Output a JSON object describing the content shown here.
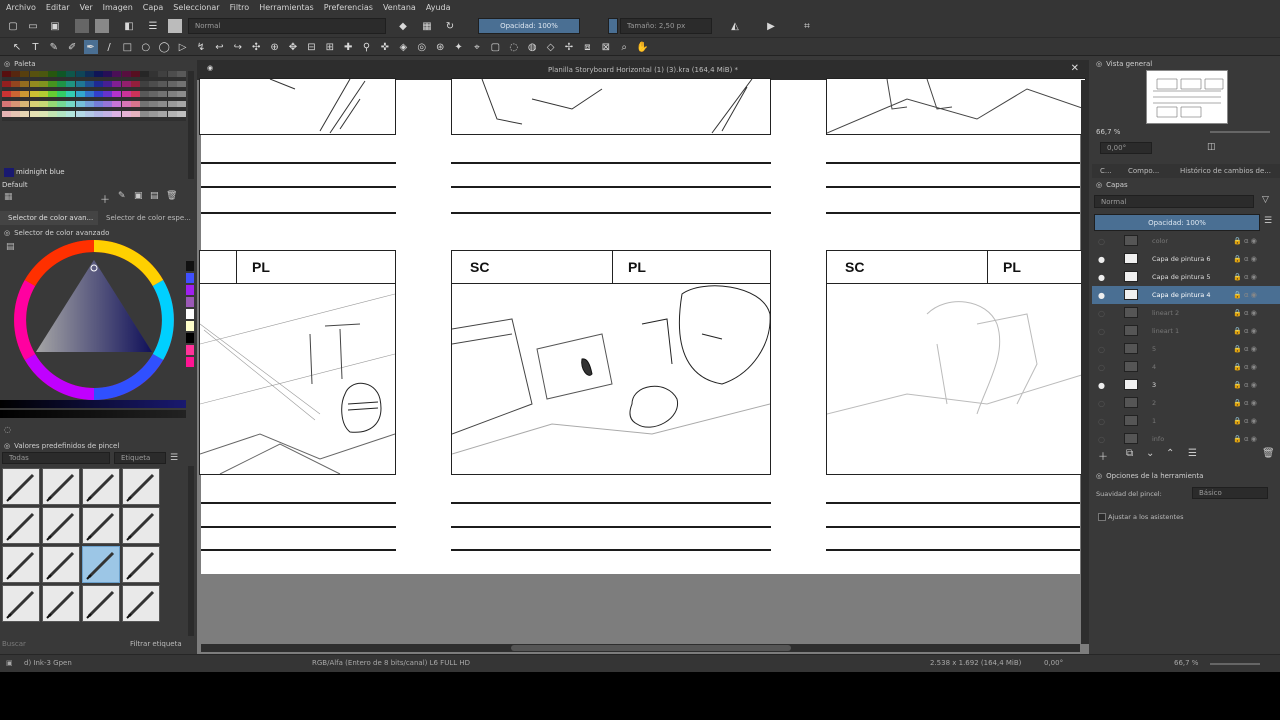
{
  "menu": [
    "Archivo",
    "Editar",
    "Ver",
    "Imagen",
    "Capa",
    "Seleccionar",
    "Filtro",
    "Herramientas",
    "Preferencias",
    "Ventana",
    "Ayuda"
  ],
  "toolbar": {
    "blend_mode": "Normal",
    "opacity": "Opacidad: 100%",
    "size": "Tamaño: 2,50 px"
  },
  "document": {
    "title": "Planilla Storyboard Horizontal (1) (3).kra (164,4 MiB) *",
    "sc_label": "SC",
    "pl_label": "PL"
  },
  "palette": {
    "title": "Paleta",
    "color_name": "midnight blue",
    "set_name": "Default"
  },
  "color_selector": {
    "tabs": [
      "Selector de color avan...",
      "Selector de color espe..."
    ],
    "title": "Selector de color avanzado"
  },
  "brush_presets": {
    "title": "Valores predefinidos de pincel",
    "filter": "Todas",
    "tag_label": "Etiqueta",
    "search_placeholder": "Buscar",
    "filter_tag": "Filtrar etiqueta"
  },
  "overview": {
    "title": "Vista general",
    "zoom": "66,7 %",
    "rotation": "0,00°"
  },
  "right_tabs": [
    "C...",
    "Compo...",
    "Histórico de cambios de..."
  ],
  "layers": {
    "title": "Capas",
    "blend_mode": "Normal",
    "opacity": "Opacidad: 100%",
    "items": [
      {
        "name": "color",
        "visible": false,
        "selected": false
      },
      {
        "name": "Capa de pintura 6",
        "visible": true,
        "selected": false
      },
      {
        "name": "Capa de pintura 5",
        "visible": true,
        "selected": false
      },
      {
        "name": "Capa de pintura 4",
        "visible": true,
        "selected": true
      },
      {
        "name": "lineart 2",
        "visible": false,
        "selected": false
      },
      {
        "name": "lineart 1",
        "visible": false,
        "selected": false
      },
      {
        "name": "5",
        "visible": false,
        "selected": false
      },
      {
        "name": "4",
        "visible": false,
        "selected": false
      },
      {
        "name": "3",
        "visible": true,
        "selected": false
      },
      {
        "name": "2",
        "visible": false,
        "selected": false
      },
      {
        "name": "1",
        "visible": false,
        "selected": false
      },
      {
        "name": "info",
        "visible": false,
        "selected": false
      }
    ]
  },
  "tool_options": {
    "title": "Opciones de la herramienta",
    "smoothing_label": "Suavidad del pincel:",
    "smoothing_value": "Básico",
    "assistants_label": "Ajustar a los asistentes"
  },
  "status": {
    "brush": "d) Ink-3 Gpen",
    "color_space": "RGB/Alfa (Entero de 8 bits/canal)  L6 FULL HD",
    "dimensions": "2.538 x 1.692 (164,4 MiB)",
    "rotation": "0,00°",
    "zoom": "66,7 %"
  },
  "colors": {
    "accent": "#4a6f93",
    "panel": "#393939",
    "dark": "#2b2b2b"
  }
}
